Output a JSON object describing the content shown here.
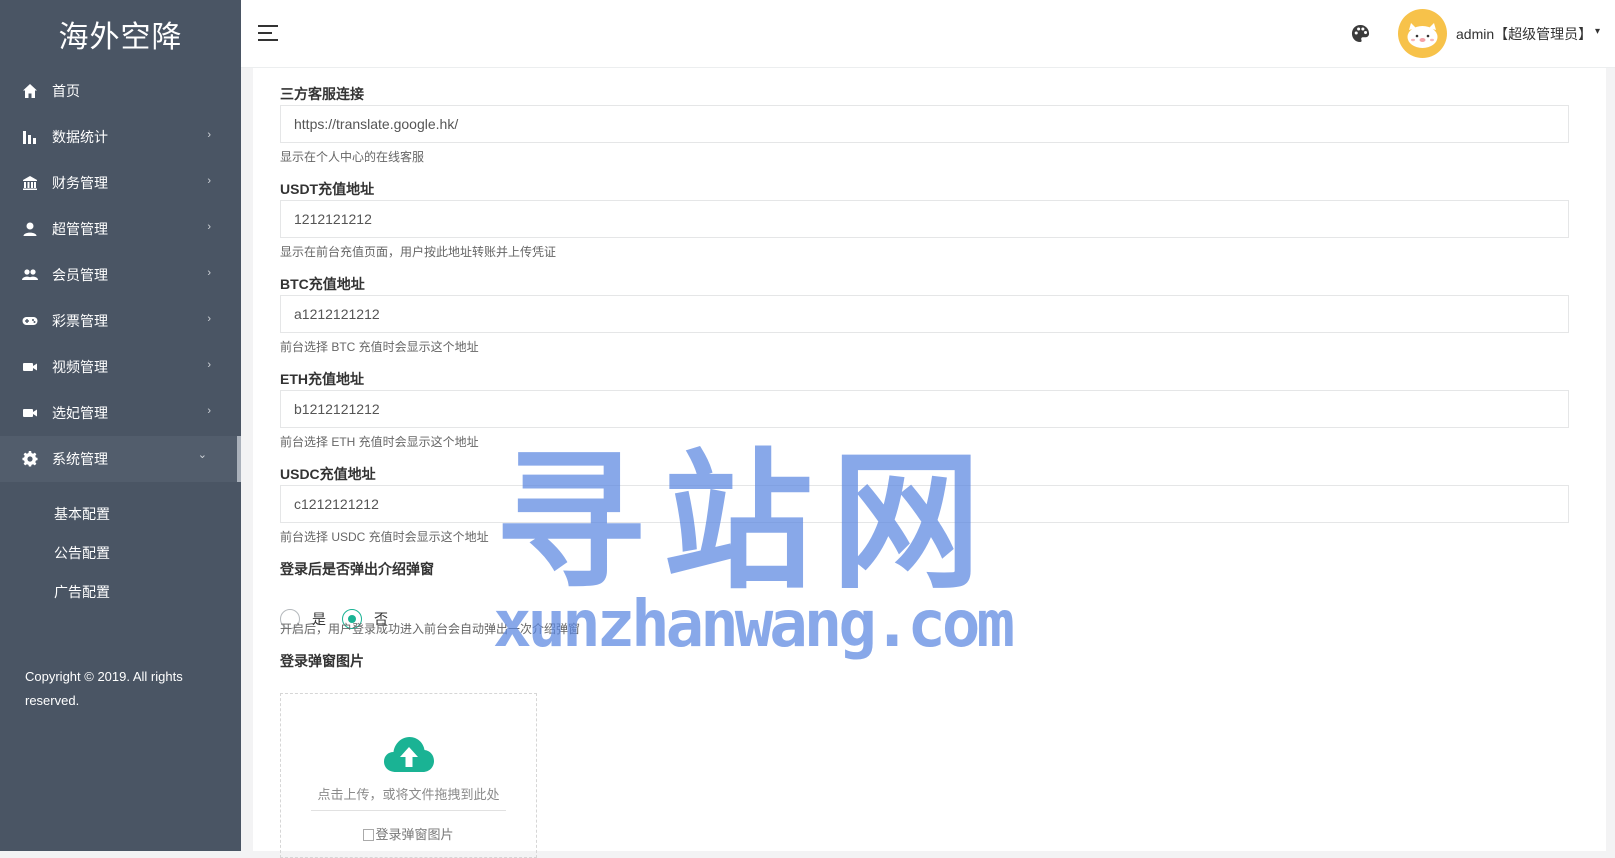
{
  "app": {
    "logo": "海外空降"
  },
  "sidebar": {
    "items": [
      {
        "label": "首页",
        "icon": "home-icon",
        "has_arrow": false
      },
      {
        "label": "数据统计",
        "icon": "bar-chart-icon",
        "has_arrow": true
      },
      {
        "label": "财务管理",
        "icon": "bank-icon",
        "has_arrow": true
      },
      {
        "label": "超管管理",
        "icon": "user-icon",
        "has_arrow": true
      },
      {
        "label": "会员管理",
        "icon": "users-icon",
        "has_arrow": true
      },
      {
        "label": "彩票管理",
        "icon": "gamepad-icon",
        "has_arrow": true
      },
      {
        "label": "视频管理",
        "icon": "video-icon",
        "has_arrow": true
      },
      {
        "label": "选妃管理",
        "icon": "video-icon",
        "has_arrow": true
      },
      {
        "label": "系统管理",
        "icon": "gear-icon",
        "has_arrow": true,
        "active": true
      }
    ],
    "arrow_right": "›",
    "arrow_down": "⌄",
    "sub_items": [
      "基本配置",
      "公告配置",
      "广告配置"
    ],
    "copyright": "Copyright © 2019. All rights reserved."
  },
  "header": {
    "user_label": "admin【超级管理员】",
    "caret": "▾",
    "icons": [
      "menu-icon",
      "palette-icon",
      "avatar"
    ]
  },
  "form": {
    "service_link": {
      "label": "三方客服连接",
      "value": "https://translate.google.hk/",
      "help": "显示在个人中心的在线客服"
    },
    "usdt": {
      "label": "USDT充值地址",
      "value": "1212121212",
      "help": "显示在前台充值页面，用户按此地址转账并上传凭证"
    },
    "btc": {
      "label": "BTC充值地址",
      "value": "a1212121212",
      "help": "前台选择 BTC 充值时会显示这个地址"
    },
    "eth": {
      "label": "ETH充值地址",
      "value": "b1212121212",
      "help": "前台选择 ETH 充值时会显示这个地址"
    },
    "usdc": {
      "label": "USDC充值地址",
      "value": "c1212121212",
      "help": "前台选择 USDC 充值时会显示这个地址"
    },
    "popup": {
      "label": "登录后是否弹出介绍弹窗",
      "options": [
        {
          "label": "是",
          "checked": false
        },
        {
          "label": "否",
          "checked": true
        }
      ],
      "help": "开启后，用户登录成功进入前台会自动弹出一次介绍弹窗"
    },
    "popup_image": {
      "label": "登录弹窗图片",
      "upload_text": "点击上传，或将文件拖拽到此处",
      "image_alt": "登录弹窗图片",
      "icon": "cloud-upload-icon"
    }
  },
  "watermark": {
    "cn": "寻站网",
    "en": "xunzhanwang.com"
  },
  "colors": {
    "sidebar": "#4a5564",
    "accent": "#1ab394",
    "watermark": "#5a87e1",
    "avatar": "#f7c24a"
  }
}
